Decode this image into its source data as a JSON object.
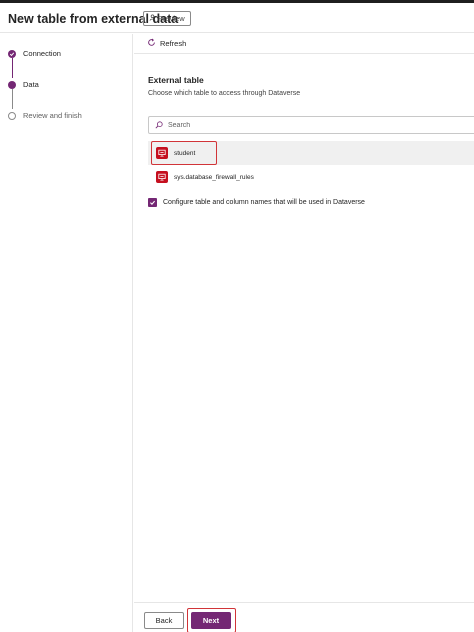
{
  "header": {
    "title": "New table from external data",
    "preview_label": "Preview"
  },
  "steps": [
    {
      "label": "Connection",
      "state": "done"
    },
    {
      "label": "Data",
      "state": "current"
    },
    {
      "label": "Review and finish",
      "state": "todo"
    }
  ],
  "toolbar": {
    "refresh_label": "Refresh"
  },
  "main": {
    "section_title": "External table",
    "section_subtitle": "Choose which table to access through Dataverse",
    "search_placeholder": "Search",
    "tables": [
      {
        "name": "student",
        "selected": true
      },
      {
        "name": "sys.database_firewall_rules",
        "selected": false
      }
    ],
    "configure_checkbox": {
      "label": "Configure table and column names that will be used in Dataverse",
      "checked": true
    }
  },
  "footer": {
    "back_label": "Back",
    "next_label": "Next"
  },
  "colors": {
    "accent": "#742774",
    "table_icon": "#c50f1f",
    "highlight": "#d13438"
  }
}
